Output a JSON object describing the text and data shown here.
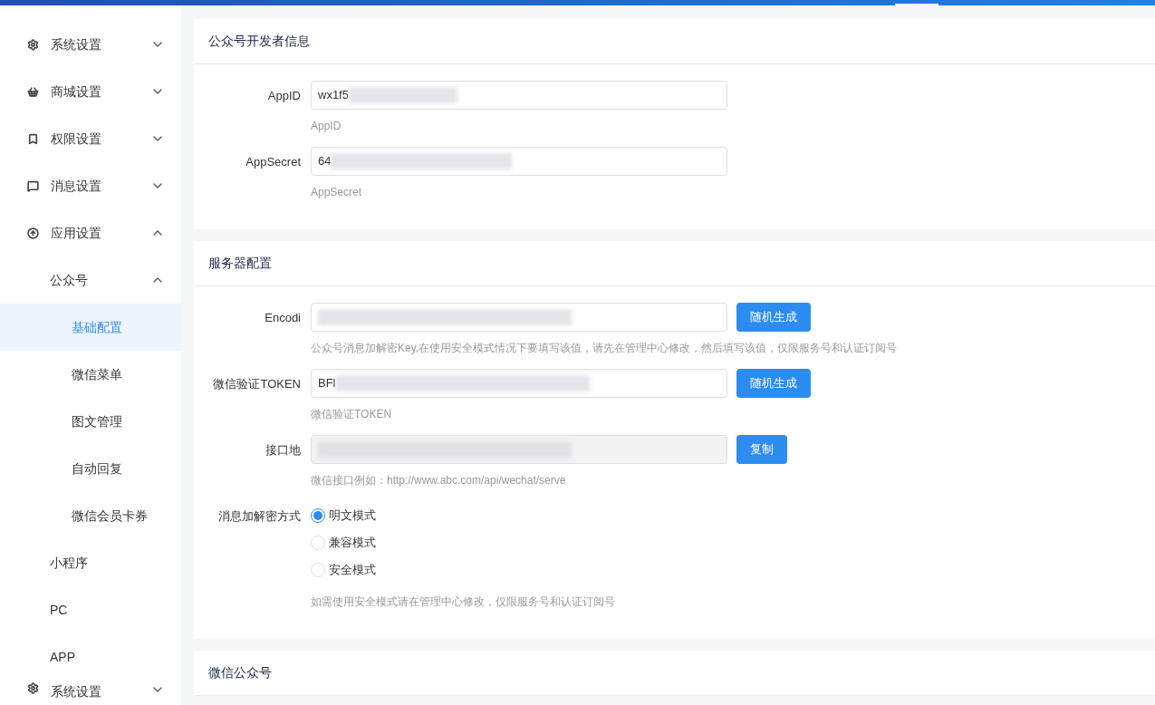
{
  "sidebar": {
    "items": [
      {
        "label": "系统设置",
        "expanded": false
      },
      {
        "label": "商城设置",
        "expanded": false
      },
      {
        "label": "权限设置",
        "expanded": false
      },
      {
        "label": "消息设置",
        "expanded": false
      },
      {
        "label": "应用设置",
        "expanded": true,
        "children": [
          {
            "label": "公众号",
            "expanded": true,
            "children": [
              {
                "label": "基础配置",
                "selected": true
              },
              {
                "label": "微信菜单",
                "selected": false
              },
              {
                "label": "图文管理",
                "selected": false
              },
              {
                "label": "自动回复",
                "selected": false
              },
              {
                "label": "微信会员卡券",
                "selected": false
              }
            ]
          },
          {
            "label": "小程序",
            "selected": false
          },
          {
            "label": "PC",
            "selected": false
          },
          {
            "label": "APP",
            "selected": false
          }
        ]
      },
      {
        "label": "系统设置",
        "expanded": false
      }
    ]
  },
  "sections": [
    {
      "title": "公众号开发者信息",
      "fields": [
        {
          "kind": "input",
          "label": "AppID",
          "value": "wx1f5",
          "hint": "AppID"
        },
        {
          "kind": "input",
          "label": "AppSecret",
          "value": "64",
          "hint": "AppSecret"
        }
      ]
    },
    {
      "title": "服务器配置",
      "fields": [
        {
          "kind": "input",
          "label": "Encodi",
          "button": "随机生成",
          "hint": "公众号消息加解密Key,在使用安全模式情况下要填写该值，请先在管理中心修改，然后填写该值，仅限服务号和认证订阅号"
        },
        {
          "kind": "input",
          "label": "微信验证TOKEN",
          "value": "BFl",
          "button": "随机生成",
          "hint": "微信验证TOKEN"
        },
        {
          "kind": "readonly",
          "label": "接口地",
          "button": "复制",
          "hint": "微信接口例如：http://www.abc.com/api/wechat/serve"
        },
        {
          "kind": "radio",
          "label": "消息加解密方式",
          "options": [
            {
              "label": "明文模式",
              "selected": true
            },
            {
              "label": "兼容模式",
              "selected": false
            },
            {
              "label": "安全模式",
              "selected": false
            }
          ],
          "hint": "如需使用安全模式请在管理中心修改，仅限服务号和认证订阅号"
        }
      ]
    },
    {
      "title": "微信公众号"
    }
  ]
}
